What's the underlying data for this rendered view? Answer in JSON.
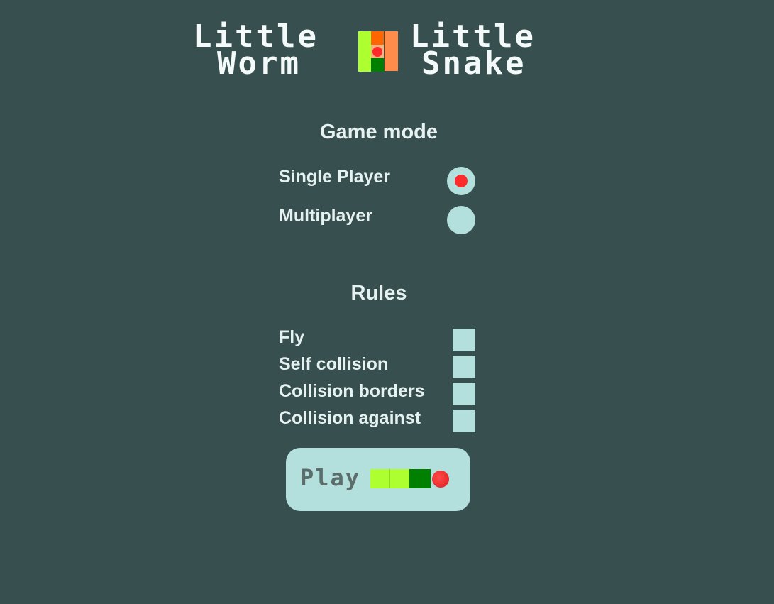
{
  "title": {
    "left_top": "Little",
    "left_bottom": "Worm",
    "right_top": "Little",
    "right_bottom": "Snake",
    "logo_icon": "snake-logo-icon"
  },
  "game_mode": {
    "heading": "Game mode",
    "options": [
      {
        "label": "Single Player",
        "selected": true
      },
      {
        "label": "Multiplayer",
        "selected": false
      }
    ]
  },
  "rules": {
    "heading": "Rules",
    "options": [
      {
        "label": "Fly",
        "checked": false
      },
      {
        "label": "Self collision",
        "checked": false
      },
      {
        "label": "Collision borders",
        "checked": false
      },
      {
        "label": "Collision against",
        "checked": false
      }
    ]
  },
  "play_button": {
    "label": "Play",
    "icon": "snake-icon"
  },
  "colors": {
    "background": "#374f4f",
    "control": "#b3e0dd",
    "accent_red": "#ff2a2a",
    "snake_light": "#adff2f",
    "snake_dark": "#008000",
    "snake_orange": "#ff8c4a"
  }
}
